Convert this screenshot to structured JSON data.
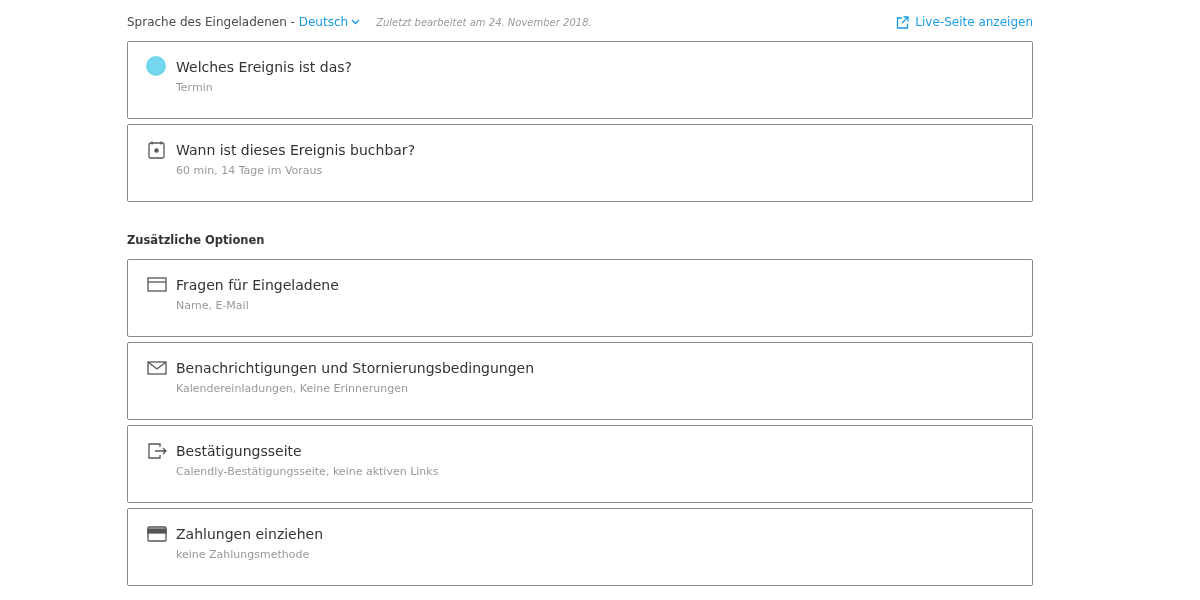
{
  "header": {
    "language_label": "Sprache des Eingeladenen - ",
    "language": "Deutsch",
    "last_edited": "Zuletzt bearbeitet am 24. November 2018.",
    "live_link": "Live-Seite anzeigen"
  },
  "main_cards": [
    {
      "kind": "dot",
      "color": "#74d7ee",
      "title": "Welches Ereignis ist das?",
      "summary": "Termin"
    },
    {
      "kind": "calendar",
      "title": "Wann ist dieses Ereignis buchbar?",
      "summary": "60 min, 14 Tage im Voraus"
    }
  ],
  "options_heading": "Zusätzliche Optionen",
  "option_cards": [
    {
      "kind": "form",
      "title": "Fragen für Eingeladene",
      "summary": "Name, E-Mail"
    },
    {
      "kind": "mail",
      "title": "Benachrichtigungen und Stornierungsbedingungen",
      "summary": "Kalendereinladungen, Keine Erinnerungen"
    },
    {
      "kind": "exit",
      "title": "Bestätigungsseite",
      "summary": "Calendly-Bestätigungsseite, keine aktiven Links"
    },
    {
      "kind": "card",
      "title": "Zahlungen einziehen",
      "summary": "keine Zahlungsmethode"
    }
  ]
}
